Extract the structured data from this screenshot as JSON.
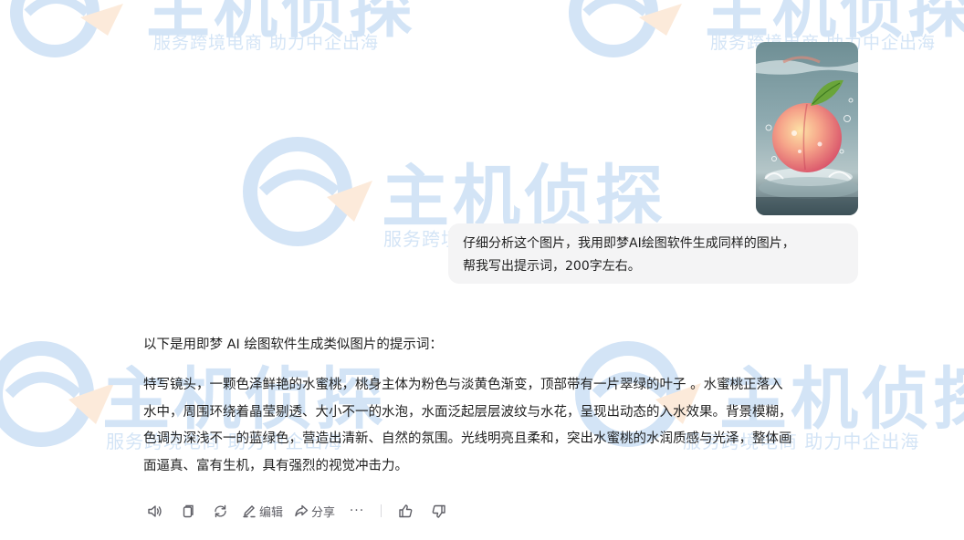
{
  "watermark": {
    "logo_text": "主机侦探",
    "slogan": "服务跨境电商 助力中企出海"
  },
  "conversation": {
    "user_image": {
      "subject": "peach-in-water"
    },
    "user_message": {
      "lines": [
        "仔细分析这个图片，我用即梦AI绘图软件生成同样的图片，",
        "帮我写出提示词，200字左右。"
      ]
    },
    "assistant_message": {
      "intro": "以下是用即梦 AI 绘图软件生成类似图片的提示词：",
      "paragraph_lines": [
        "特写镜头，一颗色泽鲜艳的水蜜桃，桃身主体为粉色与淡黄色渐变，顶部带有一片翠绿的叶子 。水蜜桃正落入",
        "水中，周围环绕着晶莹剔透、大小不一的水泡，水面泛起层层波纹与水花，呈现出动态的入水效果。背景模糊，",
        "色调为深浅不一的蓝绿色，营造出清新、自然的氛围。光线明亮且柔和，突出水蜜桃的水润质感与光泽，整体画",
        "面逼真、富有生机，具有强烈的视觉冲击力。"
      ]
    }
  },
  "actions": {
    "read_aloud_icon": "speaker-icon",
    "copy_icon": "copy-icon",
    "regenerate_icon": "refresh-icon",
    "edit_label": "编辑",
    "share_label": "分享",
    "more_label": "···",
    "like_icon": "thumbs-up-icon",
    "dislike_icon": "thumbs-down-icon"
  },
  "colors": {
    "watermark_blue": "#3a86d8",
    "watermark_orange": "#f5a35c",
    "bubble_bg": "#f4f4f5",
    "text": "#1f1f1f",
    "icon": "#5f5f66"
  }
}
